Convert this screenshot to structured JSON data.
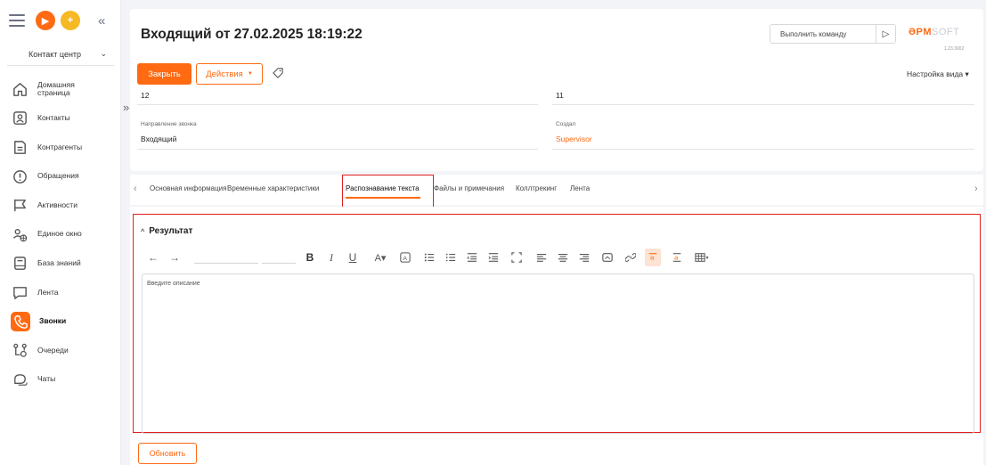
{
  "sidebar": {
    "workplace": "Контакт центр",
    "items": [
      {
        "label": "Домашняя страница",
        "icon": "home-icon"
      },
      {
        "label": "Контакты",
        "icon": "contact-icon"
      },
      {
        "label": "Контрагенты",
        "icon": "account-icon"
      },
      {
        "label": "Обращения",
        "icon": "case-icon"
      },
      {
        "label": "Активности",
        "icon": "flag-icon"
      },
      {
        "label": "Единое окно",
        "icon": "single-window-icon"
      },
      {
        "label": "База знаний",
        "icon": "knowledge-base-icon"
      },
      {
        "label": "Лента",
        "icon": "feed-icon"
      },
      {
        "label": "Звонки",
        "icon": "phone-icon",
        "active": true
      },
      {
        "label": "Очереди",
        "icon": "queue-icon"
      },
      {
        "label": "Чаты",
        "icon": "chat-icon"
      }
    ]
  },
  "header": {
    "title": "Входящий от 27.02.2025 18:19:22",
    "command_placeholder": "Выполнить команду",
    "logo_main": "ƏPM",
    "logo_soft": "SOFT",
    "version": "1.23.3002"
  },
  "actions": {
    "close": "Закрыть",
    "actions": "Действия",
    "view_settings": "Настройка вида"
  },
  "fields": {
    "left_top_value": "12",
    "right_top_value": "11",
    "direction_label": "Направление звонка",
    "direction_value": "Входящий",
    "created_label": "Создал",
    "created_value": "Supervisor"
  },
  "tabs": [
    "Основная информация",
    "Временные характеристики",
    "Распознавание текста",
    "Файлы и примечания",
    "Коллтрекинг",
    "Лента"
  ],
  "active_tab": "Распознавание текста",
  "result": {
    "title": "Результат",
    "placeholder": "Введите описание",
    "refresh": "Обновить"
  },
  "colors": {
    "accent": "#ff6a13",
    "highlight_border": "#e02020"
  }
}
